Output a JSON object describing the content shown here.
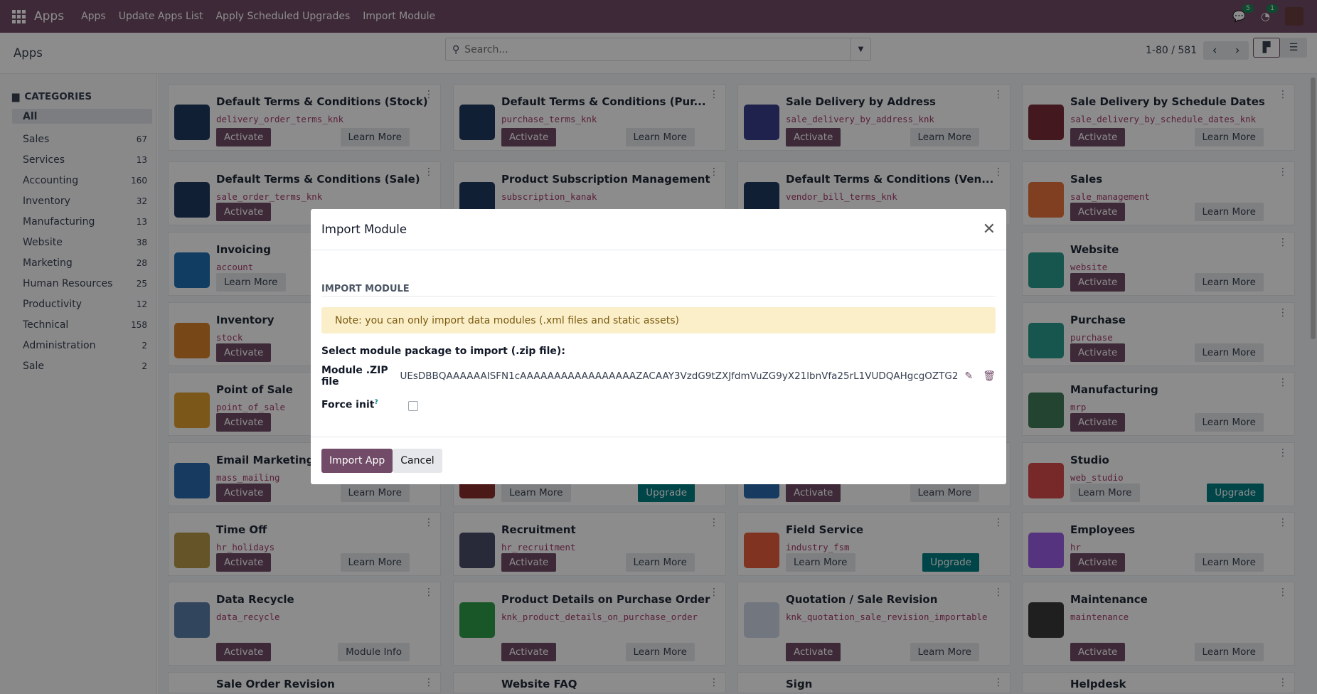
{
  "navbar": {
    "brand": "Apps",
    "menu": [
      "Apps",
      "Update Apps List",
      "Apply Scheduled Upgrades",
      "Import Module"
    ],
    "messages_count": "5",
    "activities_count": "1"
  },
  "control": {
    "title": "Apps",
    "search_placeholder": "Search...",
    "pager": "1-80 / 581"
  },
  "sidebar": {
    "heading": "CATEGORIES",
    "items": [
      {
        "label": "All",
        "count": ""
      },
      {
        "label": "Sales",
        "count": "67"
      },
      {
        "label": "Services",
        "count": "13"
      },
      {
        "label": "Accounting",
        "count": "160"
      },
      {
        "label": "Inventory",
        "count": "32"
      },
      {
        "label": "Manufacturing",
        "count": "13"
      },
      {
        "label": "Website",
        "count": "38"
      },
      {
        "label": "Marketing",
        "count": "28"
      },
      {
        "label": "Human Resources",
        "count": "25"
      },
      {
        "label": "Productivity",
        "count": "12"
      },
      {
        "label": "Technical",
        "count": "158"
      },
      {
        "label": "Administration",
        "count": "2"
      },
      {
        "label": "Sale",
        "count": "2"
      }
    ]
  },
  "cards": [
    {
      "col": 0,
      "row": 0,
      "title": "Default Terms & Conditions (Stock)",
      "tech": "delivery_order_terms_knk",
      "b1": "Activate",
      "b2": "Learn More",
      "color": "#1e3a5f"
    },
    {
      "col": 1,
      "row": 0,
      "title": "Default Terms & Conditions (Pur...",
      "tech": "purchase_terms_knk",
      "b1": "Activate",
      "b2": "Learn More",
      "color": "#1e3a5f"
    },
    {
      "col": 2,
      "row": 0,
      "title": "Sale Delivery by Address",
      "tech": "sale_delivery_by_address_knk",
      "b1": "Activate",
      "b2": "Learn More",
      "color": "#3b3f8f"
    },
    {
      "col": 3,
      "row": 0,
      "title": "Sale Delivery by Schedule Dates",
      "tech": "sale_delivery_by_schedule_dates_knk",
      "b1": "Activate",
      "b2": "Learn More",
      "color": "#7a2e3a"
    },
    {
      "col": 0,
      "row": 1,
      "title": "Default Terms & Conditions (Sale)",
      "tech": "sale_order_terms_knk",
      "b1": "Activate",
      "b2": "",
      "color": "#1e3a5f"
    },
    {
      "col": 1,
      "row": 1,
      "title": "Product Subscription Management",
      "tech": "subscription_kanak",
      "b1": "",
      "b2": "",
      "color": "#1e3a5f"
    },
    {
      "col": 2,
      "row": 1,
      "title": "Default Terms & Conditions (Ven...",
      "tech": "vendor_bill_terms_knk",
      "b1": "",
      "b2": "",
      "color": "#1e3a5f"
    },
    {
      "col": 3,
      "row": 1,
      "title": "Sales",
      "tech": "sale_management",
      "b1": "Activate",
      "b2": "Learn More",
      "color": "#e8743b"
    },
    {
      "col": 0,
      "row": 2,
      "title": "Invoicing",
      "tech": "account",
      "b1": "",
      "b2": "Learn More",
      "color": "#1f6fb2",
      "b2left": true
    },
    {
      "col": 3,
      "row": 2,
      "title": "Website",
      "tech": "website",
      "b1": "Activate",
      "b2": "Learn More",
      "color": "#2a9d8f"
    },
    {
      "col": 0,
      "row": 3,
      "title": "Inventory",
      "tech": "stock",
      "b1": "Activate",
      "b2": "",
      "color": "#d9822b"
    },
    {
      "col": 3,
      "row": 3,
      "title": "Purchase",
      "tech": "purchase",
      "b1": "Activate",
      "b2": "Learn More",
      "color": "#2a9d8f"
    },
    {
      "col": 0,
      "row": 4,
      "title": "Point of Sale",
      "tech": "point_of_sale",
      "b1": "Activate",
      "b2": "",
      "color": "#e0a030"
    },
    {
      "col": 3,
      "row": 4,
      "title": "Manufacturing",
      "tech": "mrp",
      "b1": "Activate",
      "b2": "Learn More",
      "color": "#3f7d5a"
    },
    {
      "col": 0,
      "row": 5,
      "title": "Email Marketing",
      "tech": "mass_mailing",
      "b1": "Activate",
      "b2": "Learn More",
      "color": "#2b6cb0"
    },
    {
      "col": 1,
      "row": 5,
      "title": "",
      "tech": "",
      "b1": "Upgrade",
      "b2": "Learn More",
      "color": "#8b2e2e",
      "b2left": true,
      "upgrade": true
    },
    {
      "col": 2,
      "row": 5,
      "title": "",
      "tech": "",
      "b1": "Activate",
      "b2": "Learn More",
      "color": "#2b6cb0"
    },
    {
      "col": 3,
      "row": 5,
      "title": "Studio",
      "tech": "web_studio",
      "b1": "Upgrade",
      "b2": "Learn More",
      "color": "#d94c4c",
      "b2left": true,
      "upgrade": true
    },
    {
      "col": 0,
      "row": 6,
      "title": "Time Off",
      "tech": "hr_holidays",
      "b1": "Activate",
      "b2": "Learn More",
      "color": "#b89a4a"
    },
    {
      "col": 1,
      "row": 6,
      "title": "Recruitment",
      "tech": "hr_recruitment",
      "b1": "Activate",
      "b2": "Learn More",
      "color": "#4a4e69"
    },
    {
      "col": 2,
      "row": 6,
      "title": "Field Service",
      "tech": "industry_fsm",
      "b1": "Upgrade",
      "b2": "Learn More",
      "color": "#e85d3b",
      "b2left": true,
      "upgrade": true
    },
    {
      "col": 3,
      "row": 6,
      "title": "Employees",
      "tech": "hr",
      "b1": "Activate",
      "b2": "Learn More",
      "color": "#9b5de5"
    },
    {
      "col": 0,
      "row": 7,
      "title": "Data Recycle",
      "tech": "data_recycle",
      "b1": "Activate",
      "b2": "Module Info",
      "color": "#5a7fa8"
    },
    {
      "col": 1,
      "row": 7,
      "title": "Product Details on Purchase Order",
      "tech": "knk_product_details_on_purchase_order",
      "b1": "Activate",
      "b2": "Learn More",
      "color": "#2e9d4a"
    },
    {
      "col": 2,
      "row": 7,
      "title": "Quotation / Sale Revision",
      "tech": "knk_quotation_sale_revision_importable",
      "b1": "Activate",
      "b2": "Learn More",
      "color": "#cfd8e6"
    },
    {
      "col": 3,
      "row": 7,
      "title": "Maintenance",
      "tech": "maintenance",
      "b1": "Activate",
      "b2": "Learn More",
      "color": "#3a3a3a"
    },
    {
      "col": 0,
      "row": 8,
      "title": "Sale Order Revision",
      "tech": "",
      "b1": "",
      "b2": "",
      "color": "#ffffff"
    },
    {
      "col": 1,
      "row": 8,
      "title": "Website FAQ",
      "tech": "",
      "b1": "",
      "b2": "",
      "color": "#ffffff"
    },
    {
      "col": 2,
      "row": 8,
      "title": "Sign",
      "tech": "",
      "b1": "",
      "b2": "",
      "color": "#ffffff"
    },
    {
      "col": 3,
      "row": 8,
      "title": "Helpdesk",
      "tech": "",
      "b1": "",
      "b2": "",
      "color": "#ffffff"
    }
  ],
  "modal": {
    "title": "Import Module",
    "section": "IMPORT MODULE",
    "note": "Note: you can only import data modules (.xml files and static assets)",
    "select_label": "Select module package to import (.zip file):",
    "file_label": "Module .ZIP file",
    "file_value": "UEsDBBQAAAAAAISFN1cAAAAAAAAAAAAAAAAAZACAAY3VzdG9tZXJfdmVuZG9yX21lbnVfa25rL1VUDQAHgcgOZTG2",
    "force_label": "Force init",
    "force_help": "?",
    "force_checked": false,
    "import_label": "Import App",
    "cancel_label": "Cancel"
  },
  "colors": {
    "primary": "#714b67",
    "upgrade": "#017e84",
    "note_bg": "#fbefca"
  }
}
